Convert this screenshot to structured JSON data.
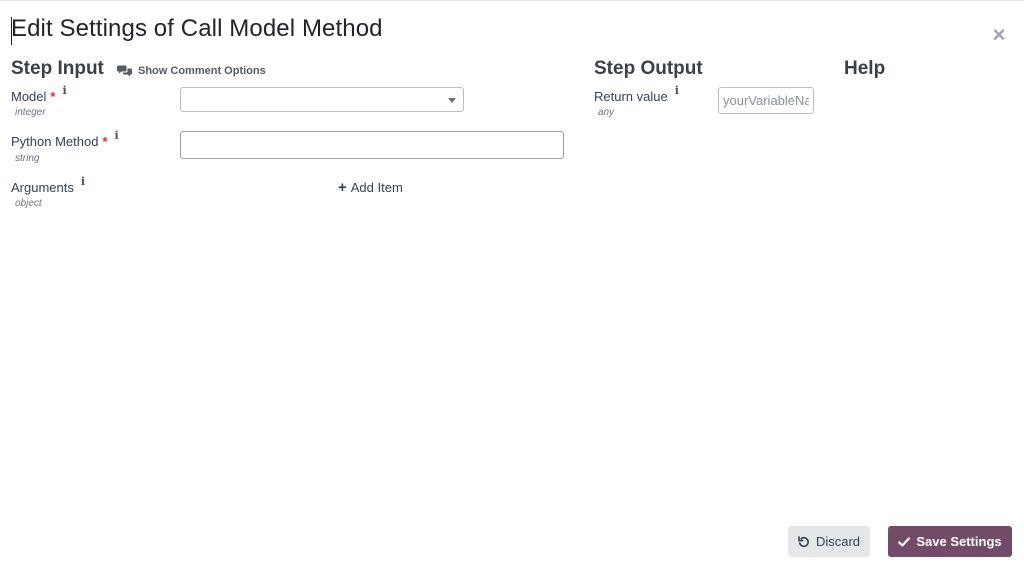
{
  "dialog": {
    "title": "Edit Settings of Call Model Method",
    "close_icon": "×"
  },
  "step_input": {
    "heading": "Step Input",
    "comment_toggle_label": "Show Comment Options",
    "fields": [
      {
        "label": "Model",
        "required": "*",
        "info": "i",
        "type": "integer",
        "control": "select",
        "value": ""
      },
      {
        "label": "Python Method",
        "required": "*",
        "info": "i",
        "type": "string",
        "control": "text",
        "value": ""
      },
      {
        "label": "Arguments",
        "info": "i",
        "type": "object",
        "control": "list"
      }
    ],
    "add_item_icon": "+",
    "add_item_label": "Add Item"
  },
  "step_output": {
    "heading": "Step Output",
    "fields": [
      {
        "label": "Return value",
        "info": "i",
        "type": "any",
        "placeholder": "yourVariableName"
      }
    ]
  },
  "help": {
    "heading": "Help"
  },
  "footer": {
    "discard_label": "Discard",
    "save_label": "Save Settings"
  },
  "colors": {
    "primary": "#714b67",
    "required": "#d0312d",
    "secondary_button": "#e5e7eb"
  }
}
